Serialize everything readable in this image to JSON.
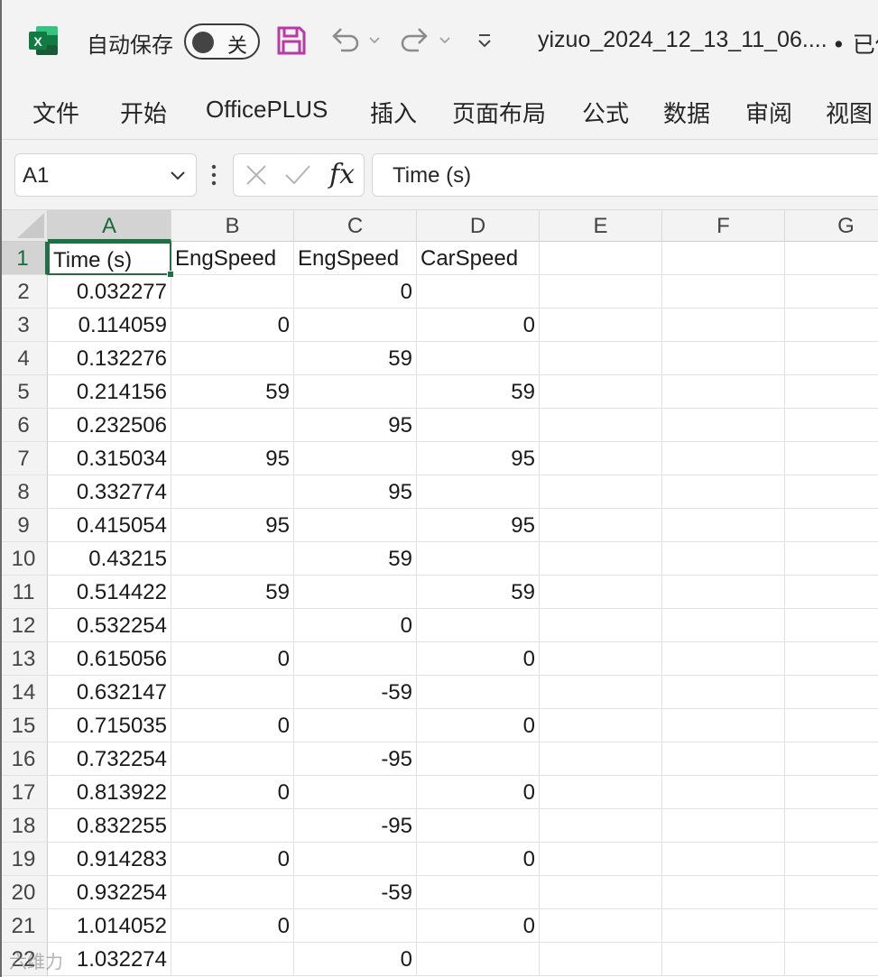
{
  "titlebar": {
    "autosave_label": "自动保存",
    "autosave_state": "关",
    "file_name": "yizuo_2024_12_13_11_06....",
    "save_status": "• 已保"
  },
  "ribbon": {
    "tabs": [
      "文件",
      "开始",
      "OfficePLUS",
      "插入",
      "页面布局",
      "公式",
      "数据",
      "审阅",
      "视图"
    ]
  },
  "formula_bar": {
    "name_box": "A1",
    "fx_label": "fx",
    "content": "Time (s)"
  },
  "colors": {
    "excel_green": "#1E7145",
    "save_icon": "#B73AA5"
  },
  "grid": {
    "columns": [
      "A",
      "B",
      "C",
      "D",
      "E",
      "F",
      "G"
    ],
    "selected_cell": "A1",
    "rows": [
      {
        "row": "1",
        "A": "Time (s)",
        "B": "EngSpeed",
        "C": "EngSpeed",
        "D": "CarSpeed"
      },
      {
        "row": "2",
        "A": "0.032277",
        "B": "",
        "C": "0",
        "D": ""
      },
      {
        "row": "3",
        "A": "0.114059",
        "B": "0",
        "C": "",
        "D": "0"
      },
      {
        "row": "4",
        "A": "0.132276",
        "B": "",
        "C": "59",
        "D": ""
      },
      {
        "row": "5",
        "A": "0.214156",
        "B": "59",
        "C": "",
        "D": "59"
      },
      {
        "row": "6",
        "A": "0.232506",
        "B": "",
        "C": "95",
        "D": ""
      },
      {
        "row": "7",
        "A": "0.315034",
        "B": "95",
        "C": "",
        "D": "95"
      },
      {
        "row": "8",
        "A": "0.332774",
        "B": "",
        "C": "95",
        "D": ""
      },
      {
        "row": "9",
        "A": "0.415054",
        "B": "95",
        "C": "",
        "D": "95"
      },
      {
        "row": "10",
        "A": "0.43215",
        "B": "",
        "C": "59",
        "D": ""
      },
      {
        "row": "11",
        "A": "0.514422",
        "B": "59",
        "C": "",
        "D": "59"
      },
      {
        "row": "12",
        "A": "0.532254",
        "B": "",
        "C": "0",
        "D": ""
      },
      {
        "row": "13",
        "A": "0.615056",
        "B": "0",
        "C": "",
        "D": "0"
      },
      {
        "row": "14",
        "A": "0.632147",
        "B": "",
        "C": "-59",
        "D": ""
      },
      {
        "row": "15",
        "A": "0.715035",
        "B": "0",
        "C": "",
        "D": "0"
      },
      {
        "row": "16",
        "A": "0.732254",
        "B": "",
        "C": "-95",
        "D": ""
      },
      {
        "row": "17",
        "A": "0.813922",
        "B": "0",
        "C": "",
        "D": "0"
      },
      {
        "row": "18",
        "A": "0.832255",
        "B": "",
        "C": "-95",
        "D": ""
      },
      {
        "row": "19",
        "A": "0.914283",
        "B": "0",
        "C": "",
        "D": "0"
      },
      {
        "row": "20",
        "A": "0.932254",
        "B": "",
        "C": "-59",
        "D": ""
      },
      {
        "row": "21",
        "A": "1.014052",
        "B": "0",
        "C": "",
        "D": "0"
      },
      {
        "row": "22",
        "A": "1.032274",
        "B": "",
        "C": "0",
        "D": ""
      }
    ]
  },
  "watermark": "六维力"
}
